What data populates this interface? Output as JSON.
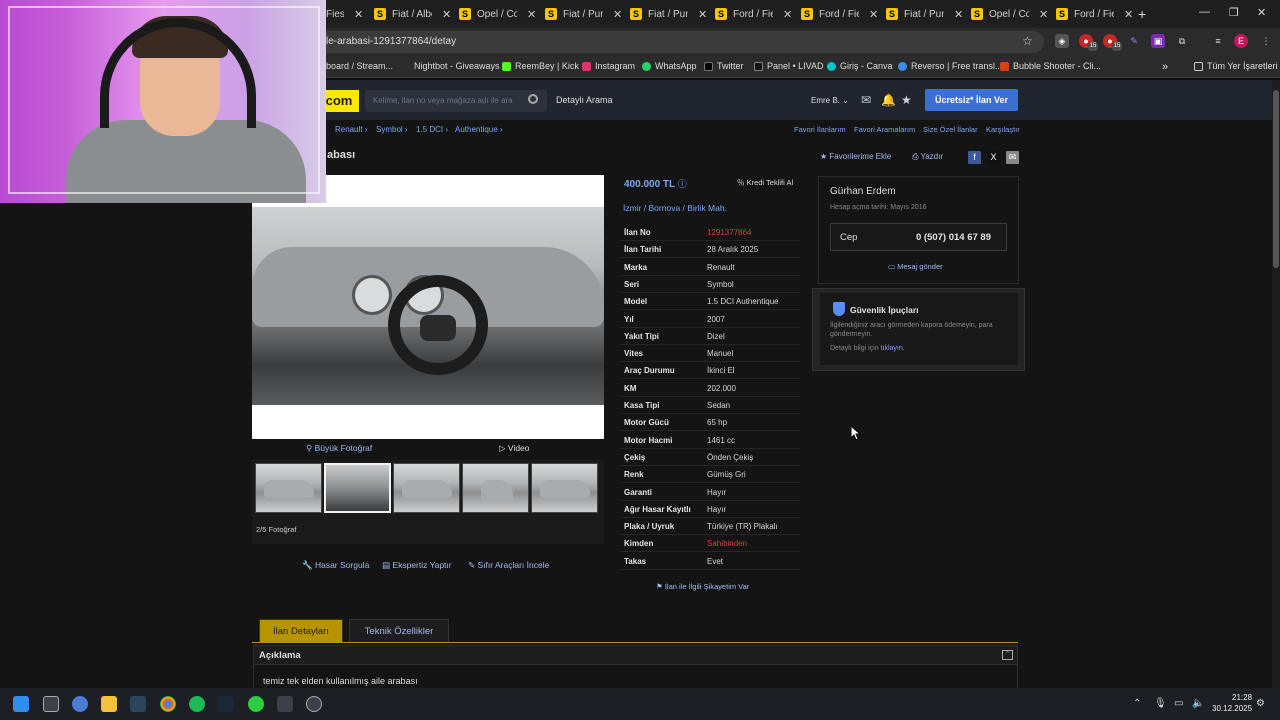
{
  "browser": {
    "tabs": [
      {
        "label": "Fies"
      },
      {
        "label": "Fiat / Albea"
      },
      {
        "label": "Opel / Cor"
      },
      {
        "label": "Fiat / Punt"
      },
      {
        "label": "Fiat / Punt"
      },
      {
        "label": "Ford / Fies"
      },
      {
        "label": "Ford / Fies"
      },
      {
        "label": "Fiat / Punt"
      },
      {
        "label": "Opel / Cor"
      },
      {
        "label": "Ford / Fies"
      }
    ],
    "url": "le-arabasi-1291377864/detay",
    "bookmarks": [
      "board / Stream...",
      "Nightbot - Giveaways",
      "ReemBey | Kick",
      "Instagram",
      "WhatsApp",
      "Twitter",
      "Panel • LIVAD",
      "Giriş - Canva",
      "Reverso | Free transl...",
      "Bubble Shooter - Cli..."
    ],
    "all_bookmarks": "Tüm Yer İşaretleri",
    "ext_badge": "15"
  },
  "site": {
    "logo": ".com",
    "search_placeholder": "Kelime, ilan no veya mağaza adı ile ara",
    "detailed_search": "Detaylı Arama",
    "user": "Emre B.",
    "post_button": "Ücretsiz* İlan Ver"
  },
  "breadcrumb": [
    "Renault",
    "Symbol",
    "1.5 DCI",
    "Authentique"
  ],
  "top_links": [
    "Favori İlanlarım",
    "Favori Aramalarım",
    "Size Özel İlanlar",
    "Karşılaştır"
  ],
  "listing": {
    "title": "abası",
    "add_favorite": "Favorilerime Ekle",
    "print": "Yazdır",
    "price": "400.000 TL",
    "credit": "Kredi Teklifi Al",
    "location": [
      "İzmir",
      "Bornova",
      "Birlik Mah."
    ],
    "big_photo": "Büyük Fotoğraf",
    "video": "Video",
    "photo_count": "2/5 Fotoğraf",
    "actions": [
      "Hasar Sorgula",
      "Ekspertiz Yaptır",
      "Sıfır Araçları İncele"
    ],
    "complaint": "İlan ile İlgili Şikayetim Var",
    "specs": [
      {
        "k": "İlan No",
        "v": "1291377864"
      },
      {
        "k": "İlan Tarihi",
        "v": "28 Aralık 2025"
      },
      {
        "k": "Marka",
        "v": "Renault"
      },
      {
        "k": "Seri",
        "v": "Symbol"
      },
      {
        "k": "Model",
        "v": "1.5 DCI Authentique"
      },
      {
        "k": "Yıl",
        "v": "2007"
      },
      {
        "k": "Yakıt Tipi",
        "v": "Dizel"
      },
      {
        "k": "Vites",
        "v": "Manuel"
      },
      {
        "k": "Araç Durumu",
        "v": "İkinci El"
      },
      {
        "k": "KM",
        "v": "202.000"
      },
      {
        "k": "Kasa Tipi",
        "v": "Sedan"
      },
      {
        "k": "Motor Gücü",
        "v": "65 hp"
      },
      {
        "k": "Motor Hacmi",
        "v": "1461 cc"
      },
      {
        "k": "Çekiş",
        "v": "Önden Çekiş"
      },
      {
        "k": "Renk",
        "v": "Gümüş Gri"
      },
      {
        "k": "Garanti",
        "v": "Hayır"
      },
      {
        "k": "Ağır Hasar Kayıtlı",
        "v": "Hayır"
      },
      {
        "k": "Plaka / Uyruk",
        "v": "Türkiye (TR) Plakalı"
      },
      {
        "k": "Kimden",
        "v": "Sahibinden"
      },
      {
        "k": "Takas",
        "v": "Evet"
      }
    ]
  },
  "seller": {
    "name": "Gürhan Erdem",
    "since": "Hesap açma tarihi: Mayıs 2016",
    "phone_label": "Cep",
    "phone": "0 (507) 014 67 89",
    "message": "Mesaj gönder"
  },
  "safety": {
    "title": "Güvenlik İpuçları",
    "text": "İlgilendiğiniz aracı görmeden kapora ödemeyin, para göndermeyin.",
    "link_prefix": "Detaylı bilgi için",
    "link": "tıklayın."
  },
  "tabs": {
    "details": "İlan Detayları",
    "tech": "Teknik Özellikler"
  },
  "description": {
    "title": "Açıklama",
    "text": "temiz tek elden kullanılmış aile arabası"
  },
  "taskbar": {
    "time": "21:28",
    "date": "30.12.2025"
  },
  "colors": {
    "accent": "#3a6fd6",
    "brand_yellow": "#ffe800",
    "link": "#7da6f5",
    "tab_active": "#b89500",
    "red": "#e23b3b"
  }
}
